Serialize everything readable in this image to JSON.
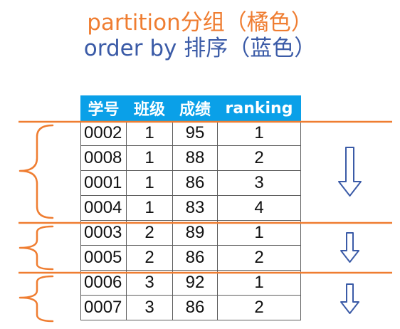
{
  "titles": {
    "partition": "partition分组（橘色）",
    "order_by": "order by 排序（蓝色）"
  },
  "table": {
    "headers": [
      "学号",
      "班级",
      "成绩",
      "ranking"
    ],
    "rows": [
      [
        "0002",
        "1",
        "95",
        "1"
      ],
      [
        "0008",
        "1",
        "88",
        "2"
      ],
      [
        "0001",
        "1",
        "86",
        "3"
      ],
      [
        "0004",
        "1",
        "83",
        "4"
      ],
      [
        "0003",
        "2",
        "89",
        "1"
      ],
      [
        "0005",
        "2",
        "86",
        "2"
      ],
      [
        "0006",
        "3",
        "92",
        "1"
      ],
      [
        "0007",
        "3",
        "86",
        "2"
      ]
    ]
  },
  "partitions": [
    {
      "rows": 4
    },
    {
      "rows": 2
    },
    {
      "rows": 2
    }
  ],
  "colors": {
    "partition": "#ef7d31",
    "order_by": "#3b5ba7",
    "header_bg": "#0aa0e8",
    "header_text": "#ffffff",
    "grid": "#5c5c5c"
  },
  "icons": {
    "partition_marker": "curly-brace-icon",
    "order_marker": "down-arrow-icon"
  }
}
